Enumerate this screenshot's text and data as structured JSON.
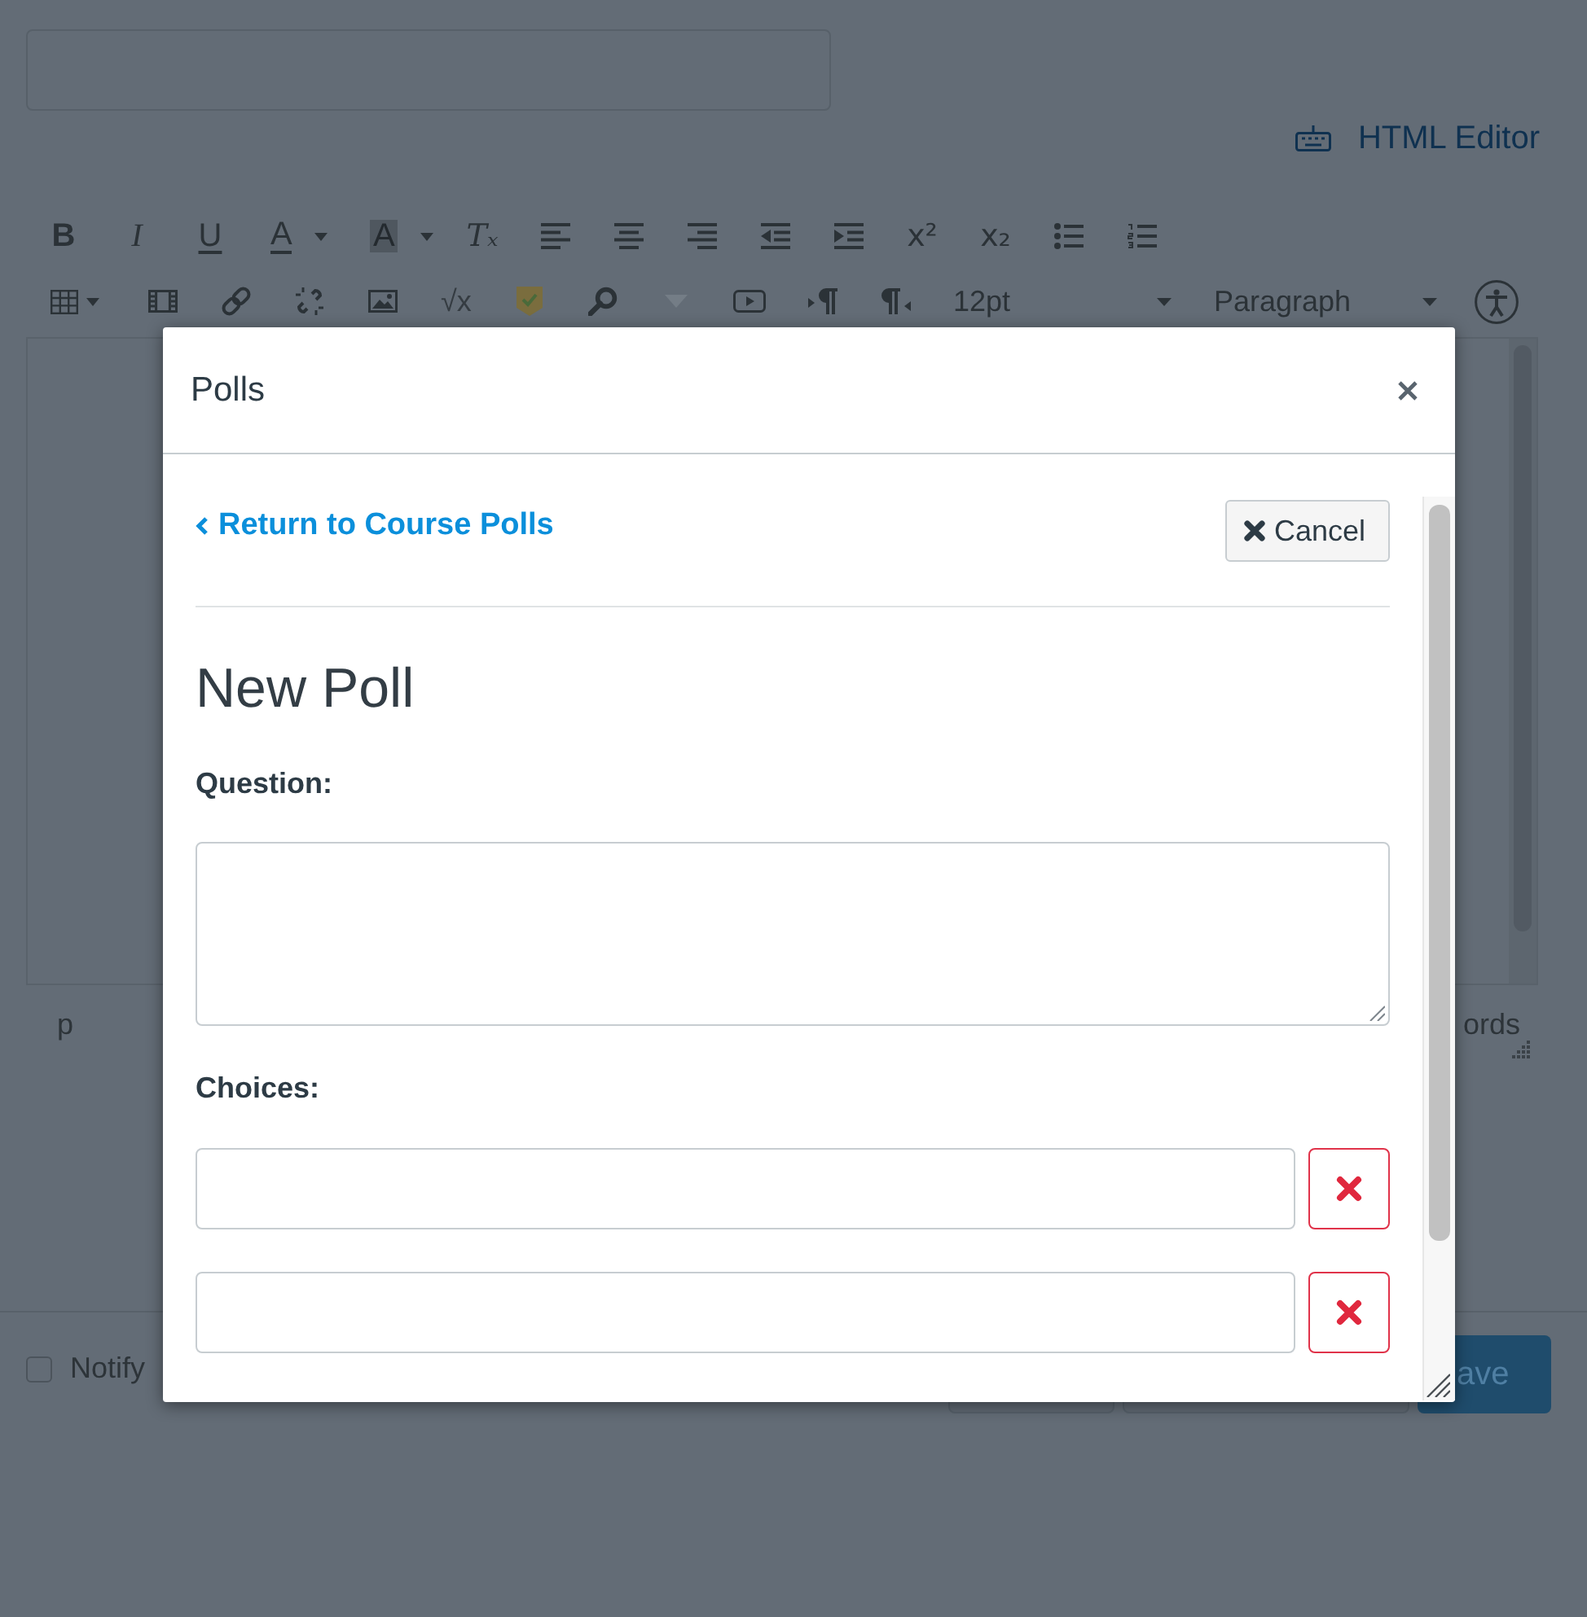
{
  "editor_page": {
    "editor_toggle": "HTML Editor",
    "toolbar": {
      "bold": "B",
      "italic": "I",
      "underline": "U",
      "text_color": "A",
      "background_color": "A",
      "clear_formatting": "Tₓ",
      "superscript": "x²",
      "subscript": "x₂",
      "equation": "√x",
      "font_size": "12pt",
      "block_format": "Paragraph"
    },
    "status_path": "p",
    "word_count": "ords",
    "notify": {
      "label": "Notify",
      "checked": false
    },
    "save_button": "ave"
  },
  "modal": {
    "title": "Polls",
    "back_link": "Return to Course Polls",
    "cancel_button": "Cancel",
    "heading": "New Poll",
    "question_label": "Question:",
    "choices_label": "Choices:",
    "choices": [
      {
        "removable": true
      },
      {
        "removable": true
      }
    ]
  }
}
